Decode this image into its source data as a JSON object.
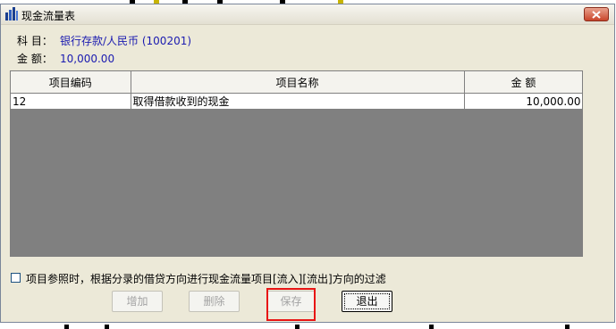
{
  "window": {
    "title": "现金流量表"
  },
  "info": {
    "subject_label": "科 目：",
    "subject_value": "银行存款/人民币 (100201)",
    "amount_label": "金 额：",
    "amount_value": "10,000.00"
  },
  "grid": {
    "columns": [
      "项目编码",
      "项目名称",
      "金  额"
    ],
    "rows": [
      {
        "code": "12",
        "name": "取得借款收到的现金",
        "amount": "10,000.00"
      }
    ]
  },
  "filter": {
    "checked": false,
    "label": "项目参照时，根据分录的借贷方向进行现金流量项目[流入][流出]方向的过滤"
  },
  "buttons": {
    "add": "增加",
    "delete": "删除",
    "save": "保存",
    "exit": "退出"
  }
}
